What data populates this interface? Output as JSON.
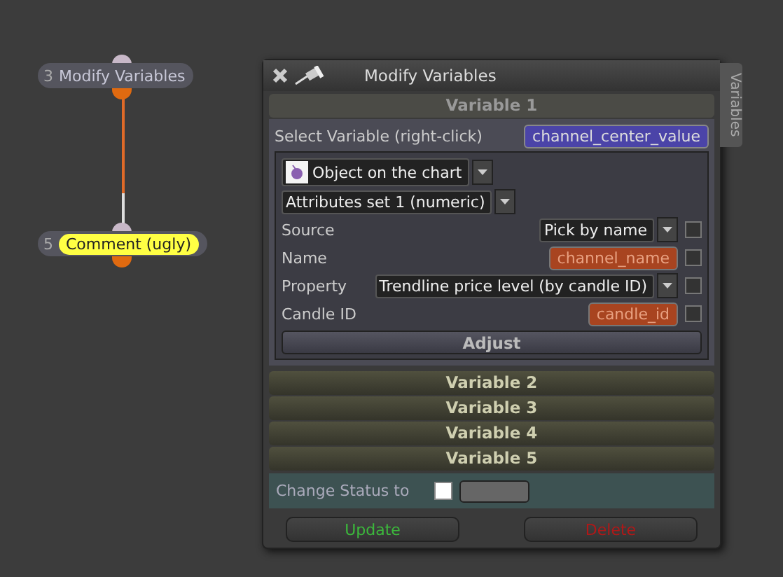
{
  "nodes": [
    {
      "number": "3",
      "label": "Modify Variables",
      "kind": "plain"
    },
    {
      "number": "5",
      "label": "Comment (ugly)",
      "kind": "comment"
    }
  ],
  "dialog": {
    "title": "Modify Variables",
    "side_tab": "Variables",
    "sections": [
      {
        "title": "Variable 1",
        "expanded": true
      },
      {
        "title": "Variable 2",
        "expanded": false
      },
      {
        "title": "Variable 3",
        "expanded": false
      },
      {
        "title": "Variable 4",
        "expanded": false
      },
      {
        "title": "Variable 5",
        "expanded": false
      }
    ],
    "select_label": "Select Variable (right-click)",
    "variable_name": "channel_center_value",
    "object_type": "Object on the chart",
    "attributes": "Attributes set 1 (numeric)",
    "fields": [
      {
        "label": "Source",
        "kind": "dropdown",
        "value": "Pick by name",
        "checked": false
      },
      {
        "label": "Name",
        "kind": "text",
        "value": "channel_name",
        "checked": false
      },
      {
        "label": "Property",
        "kind": "dropdown",
        "value": "Trendline price level (by candle ID)",
        "checked": false
      },
      {
        "label": "Candle ID",
        "kind": "text",
        "value": "candle_id",
        "checked": false
      }
    ],
    "adjust_button": "Adjust",
    "status": {
      "label": "Change Status to",
      "checked": false
    },
    "buttons": [
      {
        "label": "Update",
        "kind": "update"
      },
      {
        "label": "Delete",
        "kind": "delete"
      }
    ]
  }
}
